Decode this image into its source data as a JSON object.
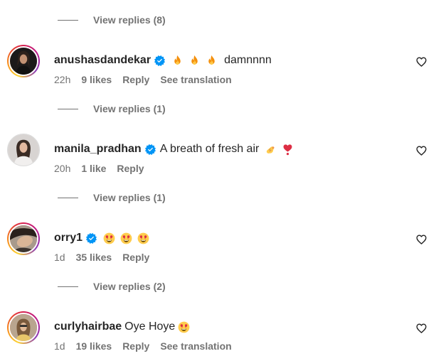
{
  "replies_links": [
    {
      "label": "View replies (8)"
    },
    {
      "label": "View replies (1)"
    },
    {
      "label": "View replies (1)"
    },
    {
      "label": "View replies (2)"
    }
  ],
  "comments": [
    {
      "username": "anushasdandekar",
      "verified": true,
      "emojis_before": [
        "fire-emoji",
        "fire-emoji",
        "fire-emoji"
      ],
      "text": "damnnnn",
      "time": "22h",
      "likes": "9 likes",
      "reply_label": "Reply",
      "translation_label": "See translation"
    },
    {
      "username": "manila_pradhan",
      "verified": true,
      "text": "A breath of fresh air",
      "emojis_after": [
        "pinched-fingers-emoji",
        "heart-exclamation-emoji"
      ],
      "time": "20h",
      "likes": "1 like",
      "reply_label": "Reply"
    },
    {
      "username": "orry1",
      "verified": true,
      "emojis_before": [
        "heart-eyes-emoji",
        "heart-eyes-emoji",
        "heart-eyes-emoji"
      ],
      "time": "1d",
      "likes": "35 likes",
      "reply_label": "Reply"
    },
    {
      "username": "curlyhairbae",
      "verified": false,
      "text": "Oye Hoye",
      "emojis_after": [
        "heart-eyes-emoji"
      ],
      "time": "1d",
      "likes": "19 likes",
      "reply_label": "Reply",
      "translation_label": "See translation"
    }
  ],
  "colors": {
    "primary_text": "#262626",
    "secondary_text": "#737373",
    "verified_blue": "#0095f6",
    "story_ring": [
      "#fdd330",
      "#f5821f",
      "#dc2743",
      "#bc1888",
      "#8a3ab9"
    ]
  },
  "icons": {
    "like": "heart-outline-icon",
    "verified": "verified-badge-icon"
  }
}
